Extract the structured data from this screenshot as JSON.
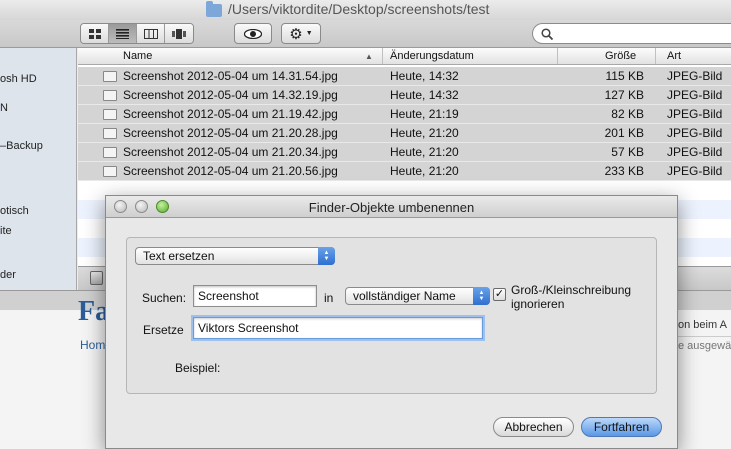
{
  "finder": {
    "path_title": "/Users/viktordite/Desktop/screenshots/test",
    "view_icons": [
      "icon-view-icon",
      "list-view-icon",
      "column-view-icon",
      "coverflow-view-icon"
    ],
    "quicklook_icon": "eye-icon",
    "action_icon": "gear-icon",
    "search_icon": "search-icon",
    "sidebar": [
      "osh HD",
      "N",
      "–Backup",
      "otisch",
      "ite",
      "der"
    ],
    "columns": {
      "name": "Name",
      "modified": "Änderungsdatum",
      "size": "Größe",
      "kind": "Art"
    },
    "files": [
      {
        "name": "Screenshot 2012-05-04 um 14.31.54.jpg",
        "modified": "Heute, 14:32",
        "size": "115 KB",
        "kind": "JPEG-Bild"
      },
      {
        "name": "Screenshot 2012-05-04 um 14.32.19.jpg",
        "modified": "Heute, 14:32",
        "size": "127 KB",
        "kind": "JPEG-Bild"
      },
      {
        "name": "Screenshot 2012-05-04 um 21.19.42.jpg",
        "modified": "Heute, 21:19",
        "size": "82 KB",
        "kind": "JPEG-Bild"
      },
      {
        "name": "Screenshot 2012-05-04 um 21.20.28.jpg",
        "modified": "Heute, 21:20",
        "size": "201 KB",
        "kind": "JPEG-Bild"
      },
      {
        "name": "Screenshot 2012-05-04 um 21.20.34.jpg",
        "modified": "Heute, 21:20",
        "size": "57 KB",
        "kind": "JPEG-Bild"
      },
      {
        "name": "Screenshot 2012-05-04 um 21.20.56.jpg",
        "modified": "Heute, 21:20",
        "size": "233 KB",
        "kind": "JPEG-Bild"
      }
    ]
  },
  "web": {
    "heading_fragment": "Fa",
    "home_link": "Hom",
    "right_text_1": "on beim A",
    "right_text_2": "e ausgewä"
  },
  "dialog": {
    "title": "Finder-Objekte umbenennen",
    "mode": "Text ersetzen",
    "find_label": "Suchen:",
    "find_value": "Screenshot",
    "in_label": "in",
    "scope": "vollständiger Name",
    "case_checkbox_line1": "Groß-/Kleinschreibung",
    "case_checkbox_line2": "ignorieren",
    "replace_label": "Ersetze",
    "replace_value": "Viktors Screenshot",
    "example_label": "Beispiel:",
    "cancel_label": "Abbrechen",
    "continue_label": "Fortfahren"
  },
  "colors": {
    "accent": "#3a7ae0",
    "selection_gray": "#d4d4d4",
    "link_blue": "#2a5d9a"
  }
}
